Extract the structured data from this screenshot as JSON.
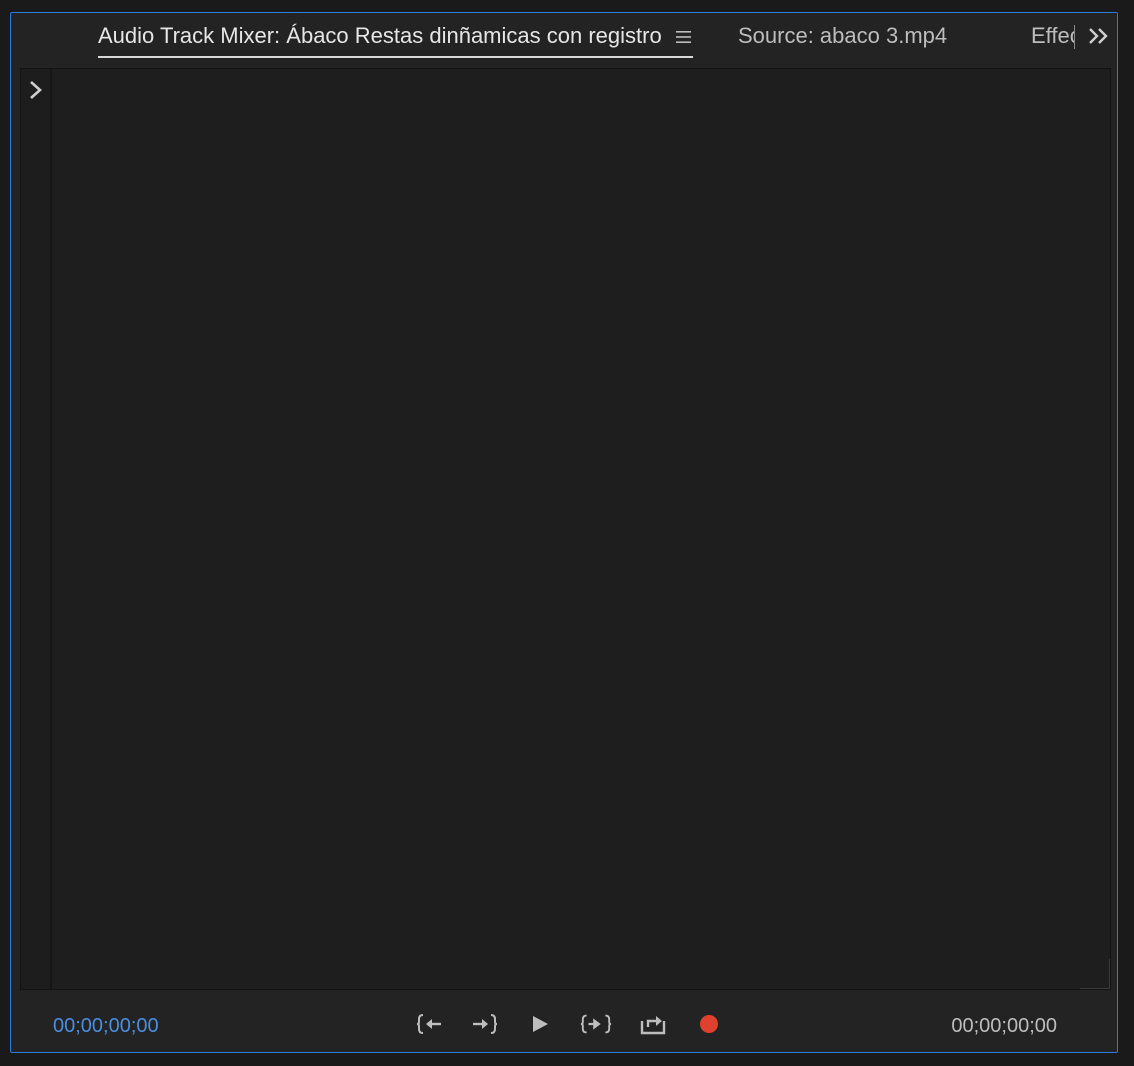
{
  "tabs": [
    {
      "label": "Audio Track Mixer: Ábaco Restas dinñamicas con registro",
      "active": true
    },
    {
      "label": "Source: abaco 3.mp4",
      "active": false
    },
    {
      "label": "Effects",
      "active": false
    }
  ],
  "icons": {
    "panel_menu": "hamburger-menu-icon",
    "overflow": "double-chevron-right-icon",
    "expand": "chevron-right-icon"
  },
  "transport": {
    "current_time": "00;00;00;00",
    "duration": "00;00;00;00",
    "buttons": [
      "go-to-in-point",
      "go-to-out-point",
      "play",
      "play-in-to-out",
      "loop",
      "record"
    ]
  },
  "colors": {
    "accent": "#2f7bd8",
    "timecode": "#4a8ee0",
    "record": "#e0412f"
  }
}
